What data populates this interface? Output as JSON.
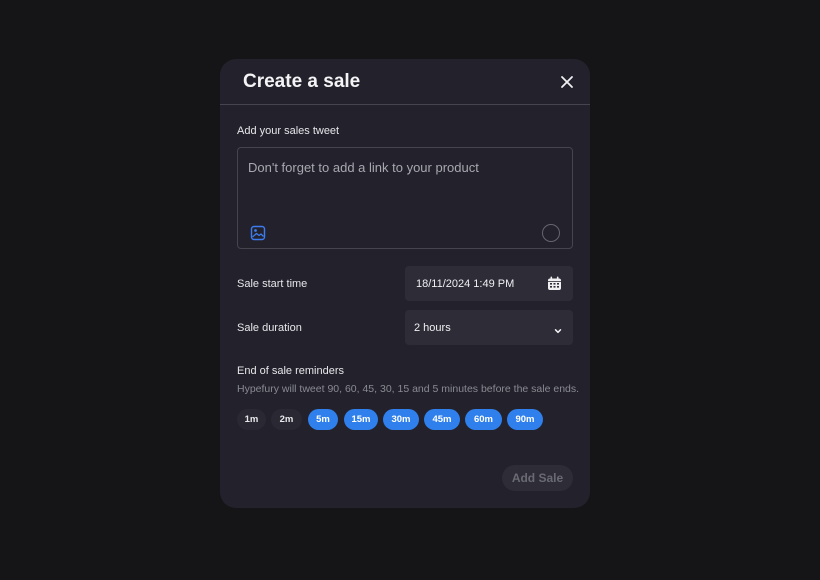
{
  "modal": {
    "title": "Create a sale"
  },
  "tweet": {
    "label": "Add your sales tweet",
    "placeholder": "Don't forget to add a link to your product"
  },
  "start_time": {
    "label": "Sale start time",
    "value": "18/11/2024 1:49 PM"
  },
  "duration": {
    "label": "Sale duration",
    "value": "2 hours"
  },
  "reminders": {
    "title": "End of sale reminders",
    "description": "Hypefury will tweet 90, 60, 45, 30, 15 and 5 minutes before the sale ends.",
    "options": [
      {
        "label": "1m",
        "selected": false
      },
      {
        "label": "2m",
        "selected": false
      },
      {
        "label": "5m",
        "selected": true
      },
      {
        "label": "15m",
        "selected": true
      },
      {
        "label": "30m",
        "selected": true
      },
      {
        "label": "45m",
        "selected": true
      },
      {
        "label": "60m",
        "selected": true
      },
      {
        "label": "90m",
        "selected": true
      }
    ]
  },
  "actions": {
    "add_sale_label": "Add Sale"
  },
  "colors": {
    "accent": "#2f80ed",
    "modal_bg": "#23222c",
    "page_bg": "#151416"
  }
}
